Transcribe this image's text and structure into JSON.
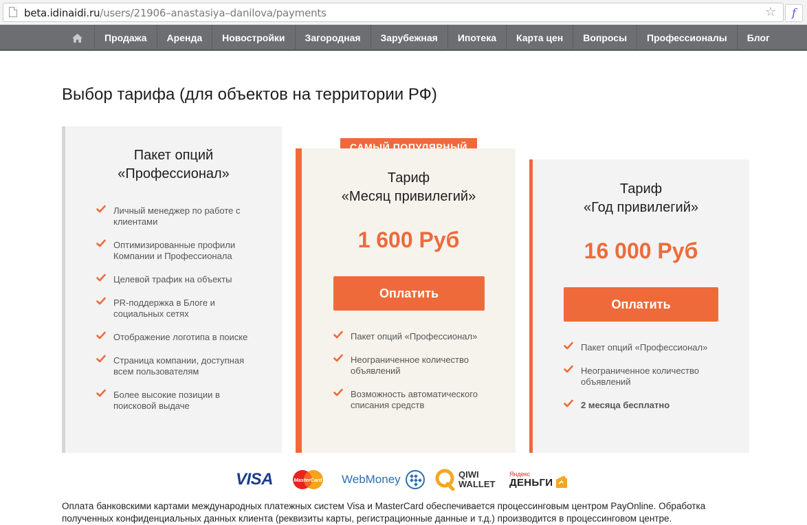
{
  "browser": {
    "url_domain": "beta.idinaidi.ru",
    "url_path": "/users/21906–anastasiya–danilova/payments"
  },
  "nav": {
    "items": [
      {
        "label": "Продажа"
      },
      {
        "label": "Аренда"
      },
      {
        "label": "Новостройки"
      },
      {
        "label": "Загородная"
      },
      {
        "label": "Зарубежная"
      },
      {
        "label": "Ипотека"
      },
      {
        "label": "Карта цен"
      },
      {
        "label": "Вопросы"
      },
      {
        "label": "Профессионалы"
      },
      {
        "label": "Блог"
      }
    ]
  },
  "page": {
    "title": "Выбор тарифа (для объектов на территории РФ)"
  },
  "plans": {
    "pro": {
      "title_line1": "Пакет опций",
      "title_line2": "«Профессионал»",
      "features": [
        "Личный менеджер по работе с клиентами",
        "Оптимизированные профили Компании и Профессионала",
        "Целевой трафик на объекты",
        "PR-поддержка в Блоге и социальных сетях",
        "Отображение логотипа в поиске",
        "Страница компании, доступная всем пользователям",
        "Более высокие позиции в поисковой выдаче"
      ]
    },
    "month": {
      "badge": "САМЫЙ ПОПУЛЯРНЫЙ",
      "title_line1": "Тариф",
      "title_line2": "«Месяц привилегий»",
      "price": "1 600 Руб",
      "button": "Оплатить",
      "features": [
        "Пакет опций «Профессионал»",
        "Неограниченное количество объявлений",
        "Возможность автоматического списания средств"
      ]
    },
    "year": {
      "title_line1": "Тариф",
      "title_line2": "«Год привилегий»",
      "price": "16 000 Руб",
      "button": "Оплатить",
      "features": [
        "Пакет опций «Профессионал»",
        "Неограниченное количество объявлений"
      ],
      "bonus": "2 месяца бесплатно"
    }
  },
  "payments": {
    "visa": "VISA",
    "mastercard": "MasterCard",
    "webmoney": "WebMoney",
    "qiwi_line1": "QIWI",
    "qiwi_line2": "WALLET",
    "yandex_line1": "Яндекс",
    "yandex_line2": "ДЕНЬГИ"
  },
  "footer": {
    "text": "Оплата банковскими картами международных платежных систем Visa и MasterCard обеспечивается процессинговым центром PayOnline. Обработка полученных конфиденциальных данных клиента (реквизиты карты, регистрационные данные и т.д.) производится в процессинговом центре."
  },
  "colors": {
    "accent": "#ee6a3a",
    "nav_bg": "#6c6e72",
    "card_bg": "#f3f3f3",
    "popular_card_bg": "#f6f3ec"
  }
}
